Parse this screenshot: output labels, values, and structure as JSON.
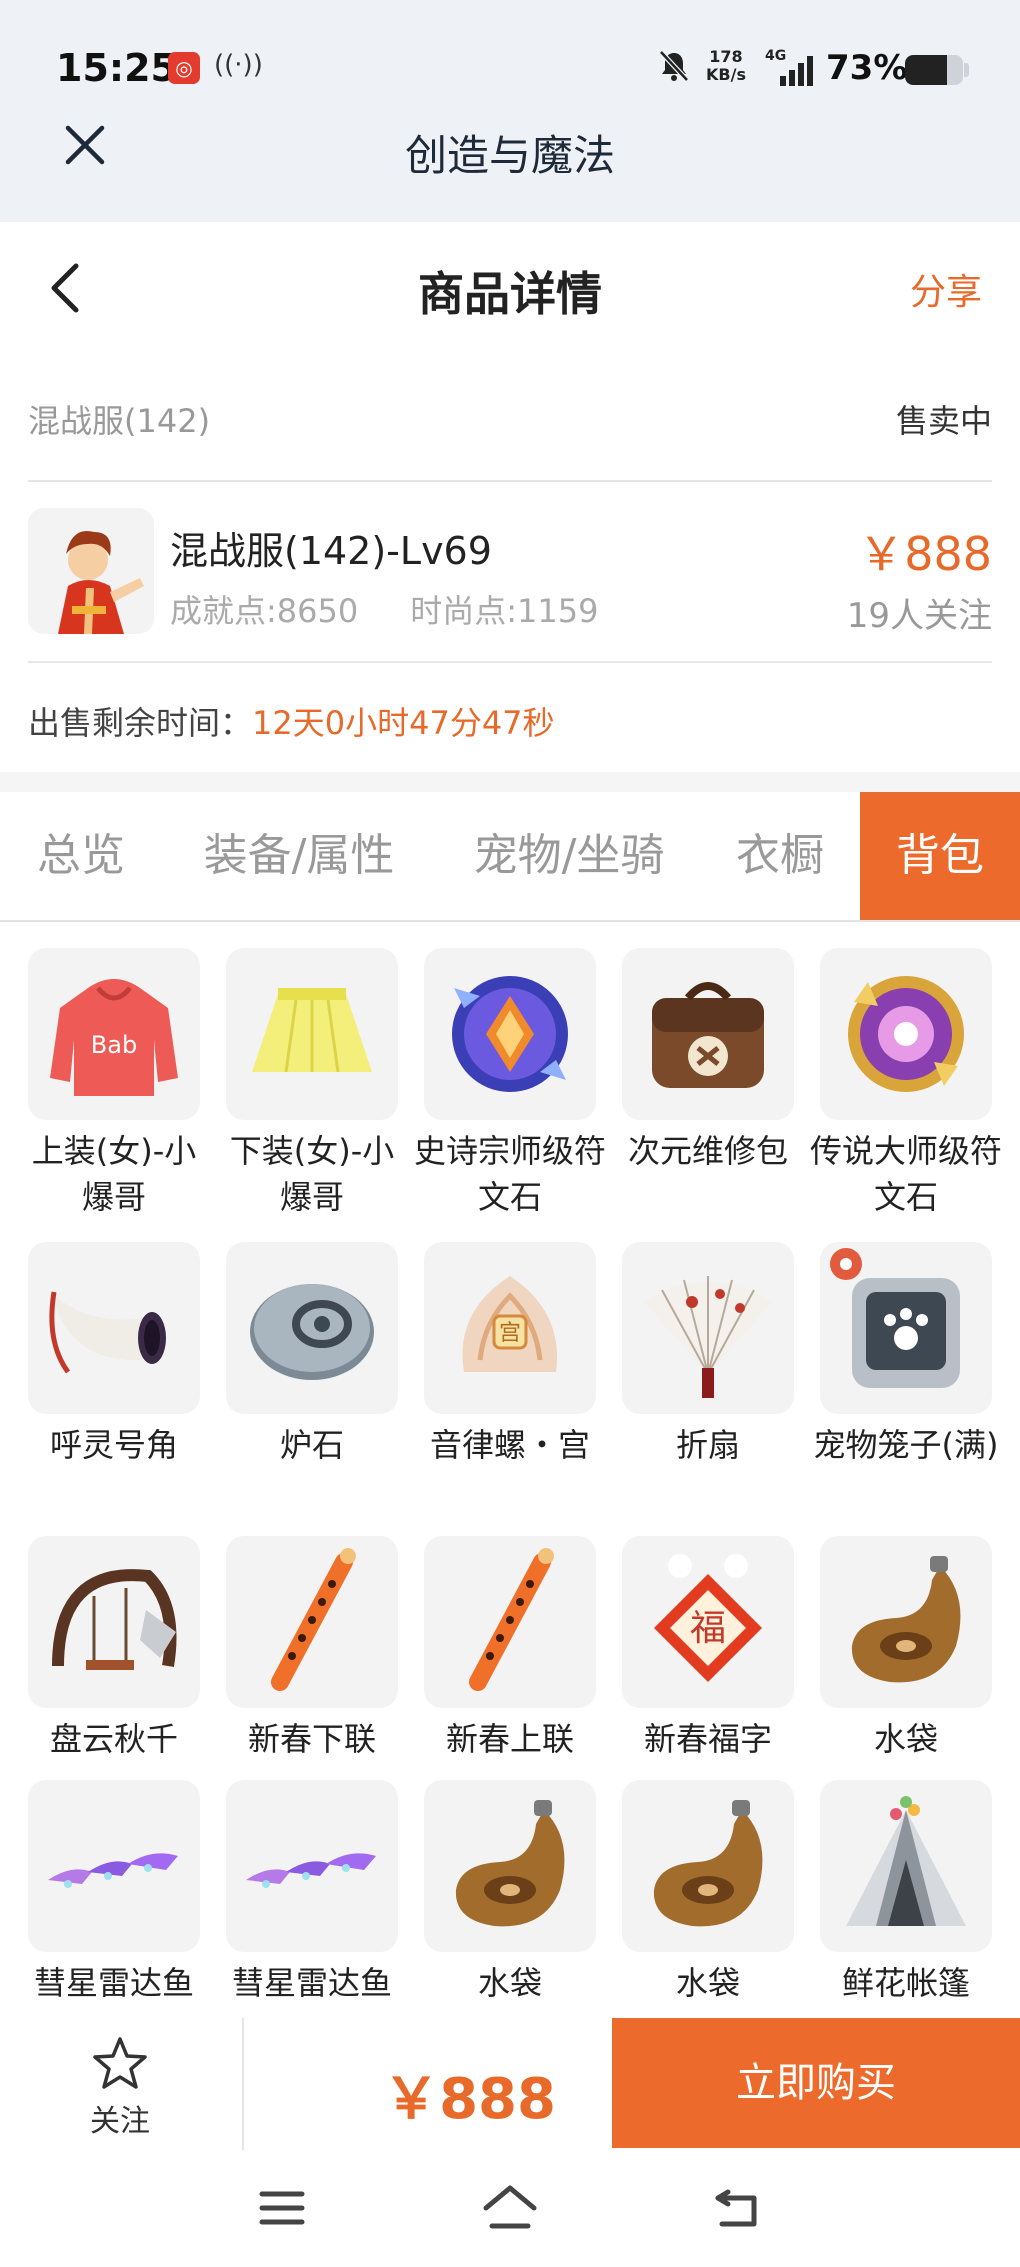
{
  "status_bar": {
    "time": "15:25",
    "net_speed_value": "178",
    "net_speed_unit": "KB/s",
    "net_type": "4G",
    "battery_percent": "73%",
    "battery_level": 0.73
  },
  "app": {
    "title": "创造与魔法"
  },
  "page": {
    "title": "商品详情",
    "share_label": "分享"
  },
  "product": {
    "server": "混战服(142)",
    "sale_status": "售卖中",
    "character_name": "混战服(142)-Lv69",
    "achievement": "成就点:8650",
    "fashion": "时尚点:1159",
    "price": "￥888",
    "followers": "19人关注",
    "remaining_label": "出售剩余时间：",
    "remaining_value": "12天0小时47分47秒"
  },
  "tabs": [
    {
      "label": "总览",
      "active": false
    },
    {
      "label": "装备/属性",
      "active": false
    },
    {
      "label": "宠物/坐骑",
      "active": false
    },
    {
      "label": "衣橱",
      "active": false
    },
    {
      "label": "背包",
      "active": true
    }
  ],
  "items": [
    {
      "name": "上装(女)-小爆哥",
      "icon": "red-hoodie-icon"
    },
    {
      "name": "下装(女)-小爆哥",
      "icon": "yellow-skirt-icon"
    },
    {
      "name": "史诗宗师级符文石",
      "icon": "epic-rune-stone-icon"
    },
    {
      "name": "次元维修包",
      "icon": "repair-bag-icon"
    },
    {
      "name": "传说大师级符文石",
      "icon": "legend-rune-stone-icon"
    },
    {
      "name": "呼灵号角",
      "icon": "horn-icon"
    },
    {
      "name": "炉石",
      "icon": "hearthstone-icon"
    },
    {
      "name": "音律螺・宫",
      "icon": "conch-icon"
    },
    {
      "name": "折扇",
      "icon": "folding-fan-icon"
    },
    {
      "name": "宠物笼子(满)",
      "icon": "pet-cage-icon"
    },
    {
      "name": "盘云秋千",
      "icon": "swing-icon"
    },
    {
      "name": "新春下联",
      "icon": "couplet-icon"
    },
    {
      "name": "新春上联",
      "icon": "couplet-icon"
    },
    {
      "name": "新春福字",
      "icon": "fu-character-icon"
    },
    {
      "name": "水袋",
      "icon": "water-bag-icon"
    },
    {
      "name": "彗星雷达鱼",
      "icon": "comet-fish-icon"
    },
    {
      "name": "彗星雷达鱼",
      "icon": "comet-fish-icon"
    },
    {
      "name": "水袋",
      "icon": "water-bag-icon"
    },
    {
      "name": "水袋",
      "icon": "water-bag-icon"
    },
    {
      "name": "鲜花帐篷",
      "icon": "flower-tent-icon"
    }
  ],
  "bottom_bar": {
    "follow_label": "关注",
    "price": "￥888",
    "buy_label": "立即购买"
  },
  "colors": {
    "accent": "#ec6a2c",
    "price": "#e86a2a",
    "header_bg": "#eef1f5"
  }
}
